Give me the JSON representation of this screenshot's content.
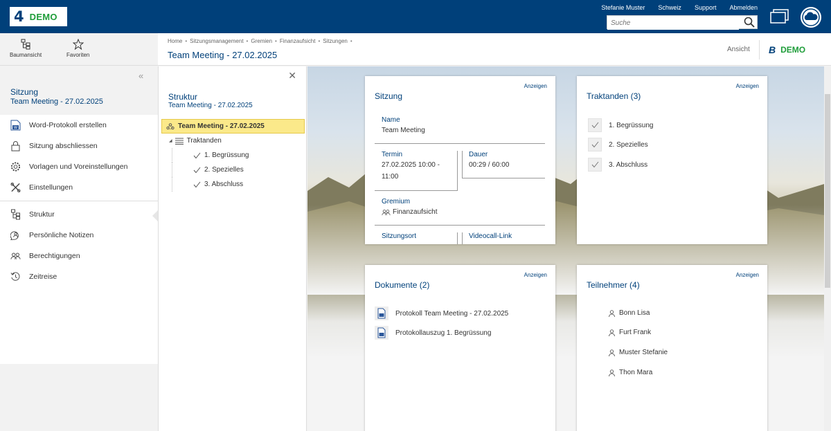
{
  "topbar": {
    "logo_mark": "4",
    "logo_text": "DEMO",
    "links": [
      "Stefanie Muster",
      "Schweiz",
      "Support",
      "Abmelden"
    ],
    "search_placeholder": "Suche"
  },
  "toolbar": {
    "tree_view_label": "Baumansicht",
    "favorites_label": "Favoriten"
  },
  "header": {
    "breadcrumbs": [
      "Home",
      "Sitzungsmanagement",
      "Gremien",
      "Finanzaufsicht",
      "Sitzungen"
    ],
    "breadcrumb_sep": "•",
    "title": "Team Meeting - 27.02.2025",
    "view_label": "Ansicht",
    "logo_mark": "B",
    "logo_text": "DEMO"
  },
  "sidebar": {
    "collapse_glyph": "«",
    "context_title": "Sitzung",
    "context_sub": "Team Meeting - 27.02.2025",
    "items": [
      {
        "label": "Word-Protokoll erstellen",
        "icon": "word-document-icon"
      },
      {
        "label": "Sitzung abschliessen",
        "icon": "lock-icon"
      },
      {
        "label": "Vorlagen und Voreinstellungen",
        "icon": "gear-icon"
      },
      {
        "label": "Einstellungen",
        "icon": "tools-icon"
      },
      {
        "label": "Struktur",
        "icon": "structure-icon"
      },
      {
        "label": "Persönliche Notizen",
        "icon": "personal-notes-icon"
      },
      {
        "label": "Berechtigungen",
        "icon": "users-icon"
      },
      {
        "label": "Zeitreise",
        "icon": "history-icon"
      }
    ]
  },
  "structure": {
    "close_glyph": "✕",
    "title": "Struktur",
    "subtitle": "Team Meeting - 27.02.2025",
    "root": "Team Meeting - 27.02.2025",
    "group": "Traktanden",
    "group_toggle": "◢",
    "items": [
      "1. Begrüssung",
      "2. Spezielles",
      "3. Abschluss"
    ]
  },
  "cards": {
    "show_label": "Anzeigen",
    "sitzung": {
      "title": "Sitzung",
      "name_label": "Name",
      "name_value": "Team Meeting",
      "termin_label": "Termin",
      "termin_value": "27.02.2025 10:00 - 11:00",
      "dauer_label": "Dauer",
      "dauer_value": "00:29 / 60:00",
      "gremium_label": "Gremium",
      "gremium_value": "Finanzaufsicht",
      "ort_label": "Sitzungsort",
      "video_label": "Videocall-Link"
    },
    "traktanden": {
      "title": "Traktanden (3)",
      "items": [
        "1. Begrüssung",
        "2. Spezielles",
        "3. Abschluss"
      ]
    },
    "dokumente": {
      "title": "Dokumente (2)",
      "items": [
        "Protokoll Team Meeting - 27.02.2025",
        "Protokollauszug 1. Begrüssung"
      ]
    },
    "teilnehmer": {
      "title": "Teilnehmer (4)",
      "items": [
        "Bonn Lisa",
        "Furt Frank",
        "Muster Stefanie",
        "Thon Mara"
      ]
    }
  },
  "colors": {
    "brand_blue": "#00407a",
    "brand_green": "#1f9d3a",
    "selection_yellow": "#fbe98a"
  }
}
